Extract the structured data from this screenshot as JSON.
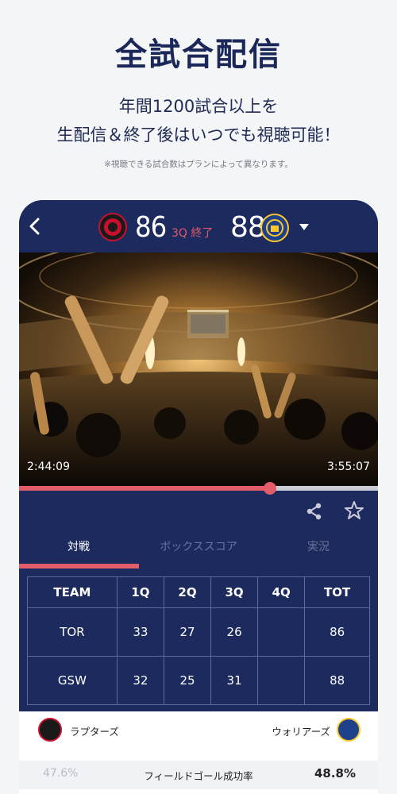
{
  "promo": {
    "title": "全試合配信",
    "line1": "年間1200試合以上を",
    "line2": "生配信＆終了後はいつでも視聴可能！",
    "note": "※視聴できる試合数はプランによって異なります。"
  },
  "header": {
    "home_score": "86",
    "status": "3Q 終了",
    "away_score": "88",
    "home_logo": "raptors-logo",
    "away_logo": "warriors-logo"
  },
  "player": {
    "current_time": "2:44:09",
    "total_time": "3:55:07",
    "progress": 0.7
  },
  "tabs": [
    {
      "label": "対戦",
      "active": true
    },
    {
      "label": "ボックススコア",
      "active": false
    },
    {
      "label": "実況",
      "active": false
    }
  ],
  "score_table": {
    "headers": [
      "TEAM",
      "1Q",
      "2Q",
      "3Q",
      "4Q",
      "TOT"
    ],
    "rows": [
      [
        "TOR",
        "33",
        "27",
        "26",
        "",
        "86"
      ],
      [
        "GSW",
        "32",
        "25",
        "31",
        "",
        "88"
      ]
    ]
  },
  "stats": {
    "home_team": "ラプターズ",
    "away_team": "ウォリアーズ",
    "label": "フィールドゴール成功率",
    "home_value": "47.6%",
    "away_value": "48.8%"
  },
  "colors": {
    "navy": "#1c2a5e",
    "accent": "#e35c6a"
  }
}
